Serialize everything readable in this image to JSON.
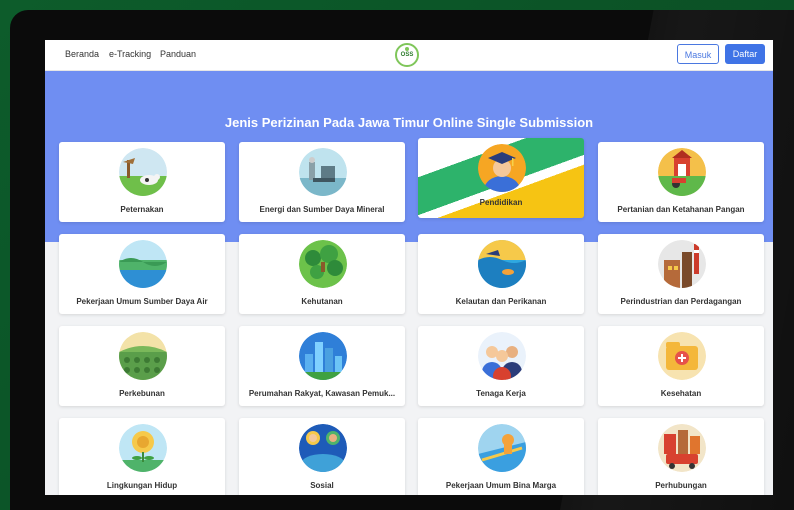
{
  "nav": {
    "links": [
      "Beranda",
      "e-Tracking",
      "Panduan"
    ],
    "logo_text": "OSS",
    "masuk_label": "Masuk",
    "daftar_label": "Daftar"
  },
  "hero": {
    "title": "Jenis Perizinan Pada Jawa Timur Online Single Submission"
  },
  "cards": [
    {
      "label": "Peternakan",
      "icon": "livestock-icon"
    },
    {
      "label": "Energi dan Sumber Daya Mineral",
      "icon": "energy-icon"
    },
    {
      "label": "Pendidikan",
      "icon": "education-icon"
    },
    {
      "label": "Pertanian dan Ketahanan Pangan",
      "icon": "agriculture-icon"
    },
    {
      "label": "Pekerjaan Umum Sumber Daya Air",
      "icon": "water-resources-icon"
    },
    {
      "label": "Kehutanan",
      "icon": "forestry-icon"
    },
    {
      "label": "Kelautan dan Perikanan",
      "icon": "marine-fisheries-icon"
    },
    {
      "label": "Perindustrian dan Perdagangan",
      "icon": "industry-trade-icon"
    },
    {
      "label": "Perkebunan",
      "icon": "plantation-icon"
    },
    {
      "label": "Perumahan Rakyat, Kawasan Pemuk...",
      "icon": "housing-icon"
    },
    {
      "label": "Tenaga Kerja",
      "icon": "workforce-icon"
    },
    {
      "label": "Kesehatan",
      "icon": "health-icon"
    },
    {
      "label": "Lingkungan Hidup",
      "icon": "environment-icon"
    },
    {
      "label": "Sosial",
      "icon": "social-icon"
    },
    {
      "label": "Pekerjaan Umum Bina Marga",
      "icon": "road-works-icon"
    },
    {
      "label": "Perhubungan",
      "icon": "transportation-icon"
    }
  ],
  "colors": {
    "hero": "#6f8ef2",
    "primary": "#3f73e6",
    "active_green": "#2db36b",
    "active_yellow": "#f6c413"
  }
}
